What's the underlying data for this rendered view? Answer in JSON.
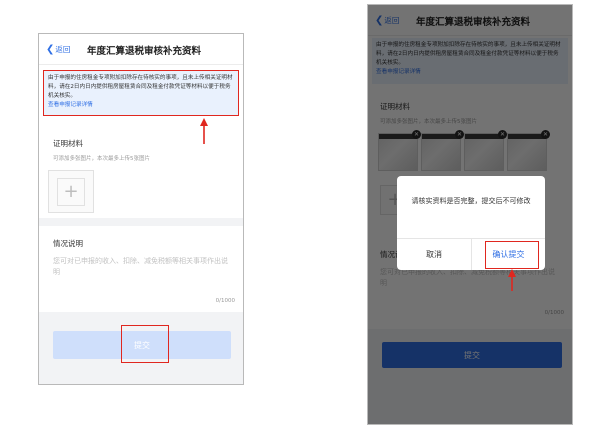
{
  "header": {
    "back_label": "返回",
    "title": "年度汇算退税审核补充资料"
  },
  "notice": {
    "text": "由于申报的住房租金专项附加扣除存在待核实的事项，且未上传相关证明材料，请在2日内日内提供租房屋租赁合同及租金付款凭证等材料以便于税务机关核实。",
    "link": "查看申报记录详情"
  },
  "proof": {
    "title": "证明材料",
    "hint": "可添加多张图片，本次最多上传5张图片"
  },
  "situation": {
    "title": "情况说明",
    "placeholder": "您可对已申报的收入、扣除、减免税额等相关事项作出说明",
    "counter": "0/1000"
  },
  "submit": {
    "label": "提交"
  },
  "dialog": {
    "message": "请核实资料是否完整，提交后不可修改",
    "cancel": "取消",
    "confirm": "确认提交"
  },
  "colors": {
    "accent": "#2f6fe4",
    "highlight_red": "#e0271f",
    "notice_bg": "#e9f1fd",
    "disabled_button": "#cfdffb"
  },
  "icons": {
    "back": "chevron-left-icon",
    "add": "plus-icon",
    "remove_photo": "close-icon",
    "pointer": "arrow-up-icon"
  }
}
